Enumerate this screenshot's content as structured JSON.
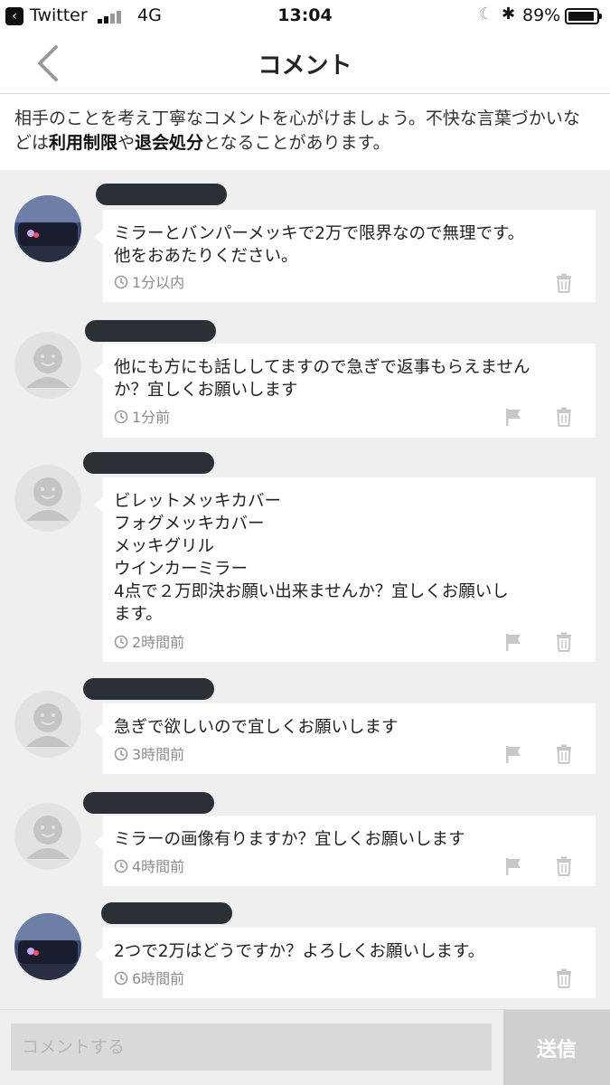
{
  "status_bar": {
    "back_app": "Twitter",
    "network": "4G",
    "time": "13:04",
    "battery": "89%"
  },
  "nav": {
    "title": "コメント",
    "back_icon": "chevron-left-icon"
  },
  "notice": {
    "part1": "相手のことを考え丁寧なコメントを心がけましょう。不快な言葉づかいなどは",
    "bold1": "利用制限",
    "part2": "や",
    "bold2": "退会処分",
    "part3": "となることがあります。"
  },
  "comments": [
    {
      "text": "ミラーとバンパーメッキで2万で限界なので無理です。\n他をおあたりください。",
      "time": "1分以内",
      "avatar": "car-photo",
      "flag": false
    },
    {
      "text": "他にも方にも話ししてますので急ぎで返事もらえません\nか？宜しくお願いします",
      "time": "1分前",
      "avatar": "default-user",
      "flag": true
    },
    {
      "text": "ビレットメッキカバー\nフォグメッキカバー\nメッキグリル\nウインカーミラー\n4点で２万即決お願い出来ませんか？宜しくお願いし\nます。",
      "time": "2時間前",
      "avatar": "default-user",
      "flag": true
    },
    {
      "text": "急ぎで欲しいので宜しくお願いします",
      "time": "3時間前",
      "avatar": "default-user",
      "flag": true
    },
    {
      "text": "ミラーの画像有りますか？宜しくお願いします",
      "time": "4時間前",
      "avatar": "default-user",
      "flag": true
    },
    {
      "text": "2つで2万はどうですか？よろしくお願いします。",
      "time": "6時間前",
      "avatar": "car-photo",
      "flag": false
    }
  ],
  "input": {
    "placeholder": "コメントする",
    "send_label": "送信"
  },
  "colors": {
    "background": "#efefef",
    "name_redaction": "#2b2f36",
    "meta_text": "#8c8c8c",
    "send_button": "#cfcfcf"
  }
}
